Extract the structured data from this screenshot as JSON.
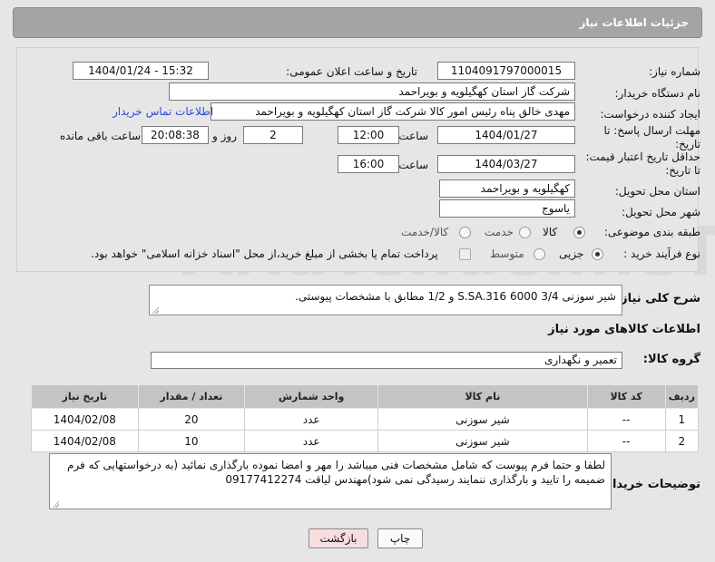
{
  "header": {
    "title": "جزئیات اطلاعات نیاز"
  },
  "watermark": {
    "text": "AriaTender.neT"
  },
  "form": {
    "need_number_label": "شماره نیاز:",
    "need_number": "1104091797000015",
    "announce_label": "تاریخ و ساعت اعلان عمومی:",
    "announce_value": "1404/01/24 - 15:32",
    "buyer_org_label": "نام دستگاه خریدار:",
    "buyer_org": "شرکت گاز استان کهگیلویه و بویراحمد",
    "creator_label": "ایجاد کننده درخواست:",
    "creator": "مهدی خالق پناه رئیس امور کالا شرکت گاز استان کهگیلویه و بویراحمد",
    "contact_link": "اطلاعات تماس خریدار",
    "deadline_label": "مهلت ارسال پاسخ: تا تاریخ:",
    "deadline_date": "1404/01/27",
    "time_label": "ساعت",
    "deadline_time": "12:00",
    "days_value": "2",
    "days_label": "روز و",
    "remaining_time": "20:08:38",
    "remaining_label": "ساعت باقی مانده",
    "price_validity_label": "حداقل تاریخ اعتبار قیمت: تا تاریخ:",
    "price_validity_date": "1404/03/27",
    "price_validity_time": "16:00",
    "province_label": "استان محل تحویل:",
    "province": "کهگیلویه و بویراحمد",
    "city_label": "شهر محل تحویل:",
    "city": "یاسوج",
    "category_label": "طبقه بندی موضوعی:",
    "category_options": [
      "کالا",
      "خدمت",
      "کالا/خدمت"
    ],
    "process_label": "نوع فرآیند خرید :",
    "process_options": [
      "جزیی",
      "متوسط"
    ],
    "payment_note": "پرداخت تمام یا بخشی از مبلغ خرید،از محل \"اسناد خزانه اسلامی\" خواهد بود."
  },
  "summary": {
    "label": "شرح کلی نیاز:",
    "text": "شیر سوزنی 3/4  S.SA.316 6000 و 1/2 مطابق با مشخصات پیوستی."
  },
  "goods": {
    "section_title": "اطلاعات کالاهای مورد نیاز",
    "group_label": "گروه کالا:",
    "group_value": "تعمیر و نگهداری",
    "columns": [
      "ردیف",
      "کد کالا",
      "نام کالا",
      "واحد شمارش",
      "تعداد / مقدار",
      "تاریخ نیاز"
    ],
    "rows": [
      {
        "row": "1",
        "code": "--",
        "name": "شیر سوزنی",
        "unit": "عدد",
        "qty": "20",
        "date": "1404/02/08"
      },
      {
        "row": "2",
        "code": "--",
        "name": "شیر سوزنی",
        "unit": "عدد",
        "qty": "10",
        "date": "1404/02/08"
      }
    ]
  },
  "buyer_notes": {
    "label": "توضیحات خریدار:",
    "text": "لطفا و حتما فرم پیوست که شامل مشخصات فنی میباشد را مهر و امضا نموده بارگذاری نمائید (به درخواستهایی که فرم ضمیمه را تایید و بارگذاری ننمایند رسیدگی نمی شود)مهندس لیاقت 09177412274"
  },
  "buttons": {
    "print": "چاپ",
    "back": "بازگشت"
  },
  "colors": {
    "header_bg": "#a4a4a4",
    "page_bg": "#e6e6e6",
    "link": "#2a4bd6",
    "back_button_bg": "#f7dede",
    "table_header_bg": "#c4c4c4"
  }
}
